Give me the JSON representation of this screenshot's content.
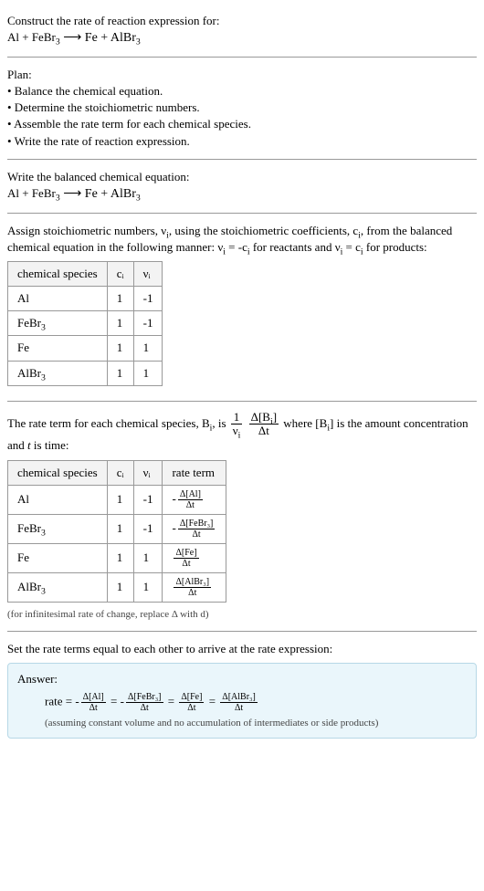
{
  "prompt": {
    "line1": "Construct the rate of reaction expression for:",
    "line2_prefix": "Al + FeBr",
    "line2_sub1": "3",
    "line2_arrow": " ⟶ Fe + AlBr",
    "line2_sub2": "3"
  },
  "plan": {
    "heading": "Plan:",
    "items": [
      "• Balance the chemical equation.",
      "• Determine the stoichiometric numbers.",
      "• Assemble the rate term for each chemical species.",
      "• Write the rate of reaction expression."
    ]
  },
  "balanced": {
    "heading": "Write the balanced chemical equation:",
    "eq_prefix": "Al + FeBr",
    "eq_sub1": "3",
    "eq_arrow": " ⟶ Fe + AlBr",
    "eq_sub2": "3"
  },
  "assign": {
    "text1": "Assign stoichiometric numbers, ν",
    "text1_sub": "i",
    "text2": ", using the stoichiometric coefficients, c",
    "text2_sub": "i",
    "text3": ", from the balanced chemical equation in the following manner: ν",
    "text3_sub": "i",
    "text4": " = -c",
    "text4_sub": "i",
    "text5": " for reactants and ν",
    "text5_sub": "i",
    "text6": " = c",
    "text6_sub": "i",
    "text7": " for products:"
  },
  "table1": {
    "headers": {
      "h1": "chemical species",
      "h2": "cᵢ",
      "h3": "νᵢ"
    },
    "rows": [
      {
        "species": "Al",
        "c": "1",
        "nu": "-1"
      },
      {
        "species_prefix": "FeBr",
        "species_sub": "3",
        "c": "1",
        "nu": "-1"
      },
      {
        "species": "Fe",
        "c": "1",
        "nu": "1"
      },
      {
        "species_prefix": "AlBr",
        "species_sub": "3",
        "c": "1",
        "nu": "1"
      }
    ]
  },
  "rateterm": {
    "p1": "The rate term for each chemical species, B",
    "p1_sub": "i",
    "p2": ", is ",
    "frac1_num": "1",
    "frac1_den_pre": "ν",
    "frac1_den_sub": "i",
    "frac2_num_pre": "Δ[B",
    "frac2_num_sub": "i",
    "frac2_num_post": "]",
    "frac2_den": "Δt",
    "p3": " where [B",
    "p3_sub": "i",
    "p4": "] is the amount concentration and ",
    "p5_italic": "t",
    "p6": " is time:"
  },
  "table2": {
    "headers": {
      "h1": "chemical species",
      "h2": "cᵢ",
      "h3": "νᵢ",
      "h4": "rate term"
    },
    "rows": [
      {
        "species": "Al",
        "c": "1",
        "nu": "-1",
        "rate_sign": "-",
        "rate_num": "Δ[Al]",
        "rate_den": "Δt"
      },
      {
        "species_prefix": "FeBr",
        "species_sub": "3",
        "c": "1",
        "nu": "-1",
        "rate_sign": "-",
        "rate_num": "Δ[FeBr₃]",
        "rate_den": "Δt"
      },
      {
        "species": "Fe",
        "c": "1",
        "nu": "1",
        "rate_sign": "",
        "rate_num": "Δ[Fe]",
        "rate_den": "Δt"
      },
      {
        "species_prefix": "AlBr",
        "species_sub": "3",
        "c": "1",
        "nu": "1",
        "rate_sign": "",
        "rate_num": "Δ[AlBr₃]",
        "rate_den": "Δt"
      }
    ],
    "note": "(for infinitesimal rate of change, replace Δ with d)"
  },
  "final": {
    "heading": "Set the rate terms equal to each other to arrive at the rate expression:"
  },
  "answer": {
    "label": "Answer:",
    "prefix": "rate = ",
    "t1_sign": "-",
    "t1_num": "Δ[Al]",
    "t1_den": "Δt",
    "eq": " = ",
    "t2_sign": "-",
    "t2_num": "Δ[FeBr₃]",
    "t2_den": "Δt",
    "t3_sign": "",
    "t3_num": "Δ[Fe]",
    "t3_den": "Δt",
    "t4_sign": "",
    "t4_num": "Δ[AlBr₃]",
    "t4_den": "Δt",
    "note": "(assuming constant volume and no accumulation of intermediates or side products)"
  }
}
